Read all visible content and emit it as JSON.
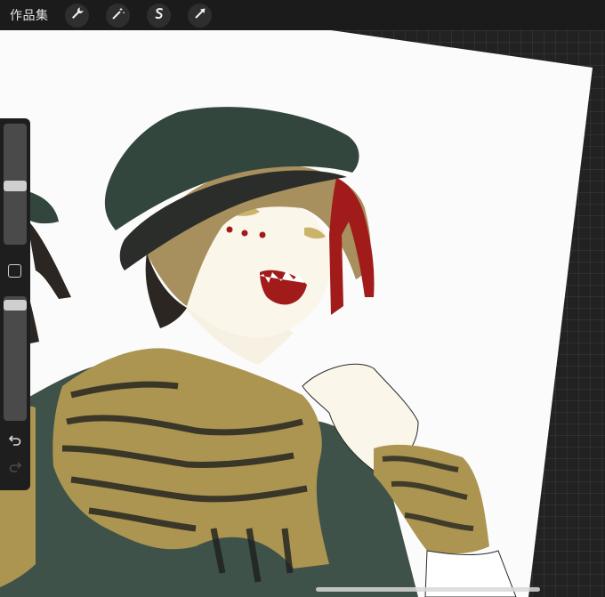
{
  "topbar": {
    "gallery_label": "作品集",
    "tools": [
      {
        "icon": "wrench-icon"
      },
      {
        "icon": "magic-wand-icon"
      },
      {
        "icon": "selection-s-icon"
      },
      {
        "icon": "transform-arrow-icon"
      }
    ]
  },
  "sidebar": {
    "brush_size": 0.52,
    "brush_opacity": 0.0
  },
  "colors": {
    "hat": "#33463d",
    "scarf": "#ab9550",
    "jacket": "#3e5249",
    "hair": "#a78f5e",
    "accent_red": "#a11b1b"
  }
}
